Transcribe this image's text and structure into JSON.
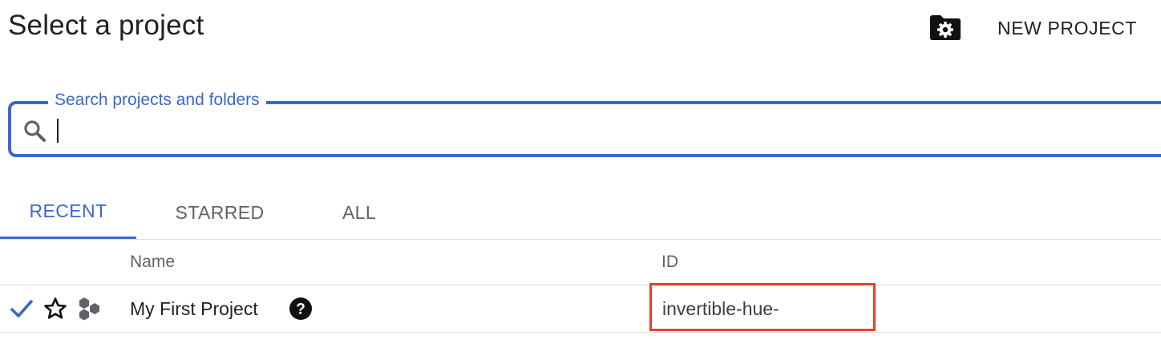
{
  "header": {
    "title": "Select a project",
    "manage_icon": "folder-gear-icon",
    "new_project_label": "NEW PROJECT"
  },
  "search": {
    "label": "Search projects and folders",
    "value": "",
    "placeholder": ""
  },
  "tabs": [
    {
      "label": "RECENT",
      "active": true
    },
    {
      "label": "STARRED",
      "active": false
    },
    {
      "label": "ALL",
      "active": false
    }
  ],
  "table": {
    "columns": [
      "Name",
      "ID"
    ],
    "rows": [
      {
        "selected": true,
        "starred": false,
        "icons": [
          "check-icon",
          "star-outline-icon",
          "project-resource-icon",
          "help-icon"
        ],
        "name": "My First Project",
        "id": "invertible-hue-"
      }
    ]
  },
  "colors": {
    "accent": "#3c68cb",
    "highlight_border": "#e8402a",
    "divider": "#dadce0",
    "text_primary": "#202124",
    "text_secondary": "#5f6368"
  }
}
